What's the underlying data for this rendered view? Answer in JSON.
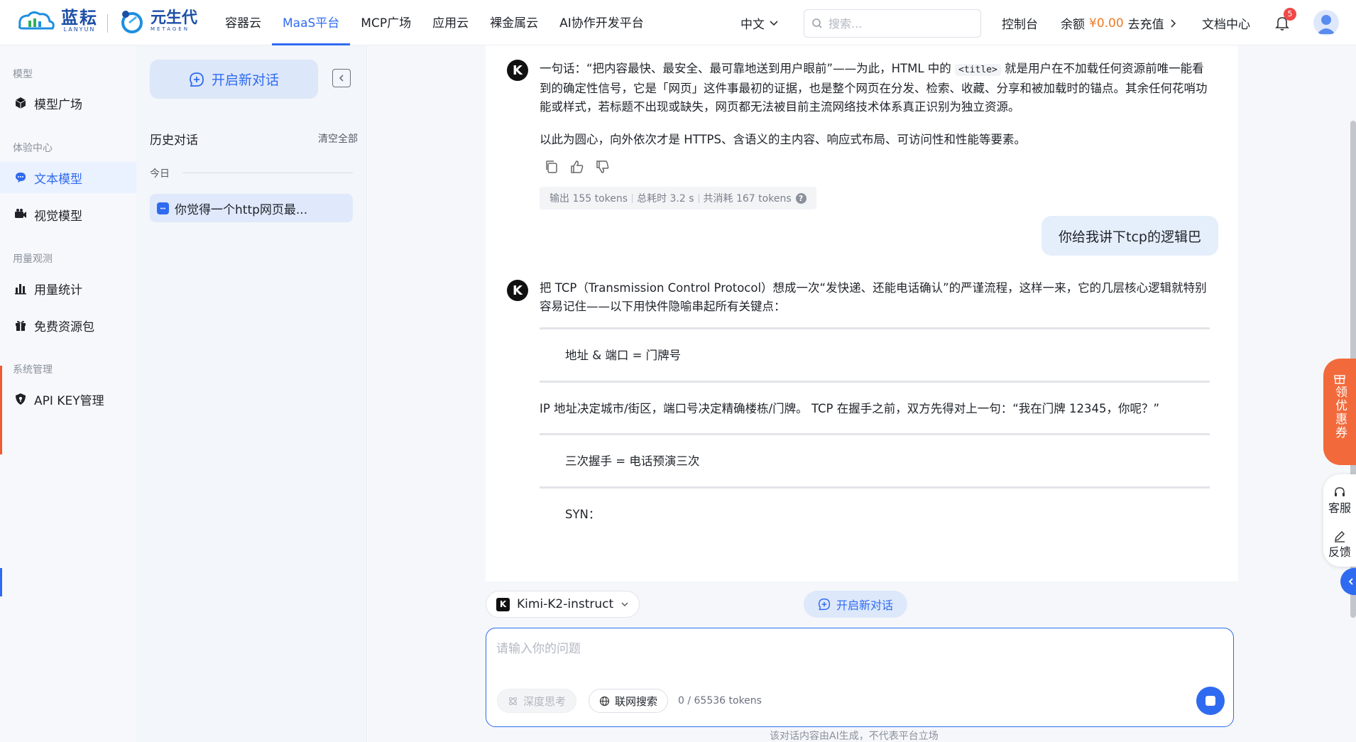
{
  "brand": {
    "logo1_name": "蓝耘",
    "logo1_sub": "LANYUN",
    "logo2_name": "元生代",
    "logo2_sub": "METAGEN"
  },
  "nav": {
    "items": [
      "容器云",
      "MaaS平台",
      "MCP广场",
      "应用云",
      "裸金属云",
      "AI协作开发平台"
    ],
    "active": "MaaS平台",
    "language": "中文",
    "search_placeholder": "搜索...",
    "console": "控制台",
    "balance_label": "余额",
    "balance_amount": "¥0.00",
    "recharge": "去充值",
    "docs": "文档中心",
    "notification_count": "5"
  },
  "sidebar": {
    "groups": [
      {
        "title": "模型",
        "items": [
          {
            "label": "模型广场",
            "icon": "cube-icon"
          }
        ]
      },
      {
        "title": "体验中心",
        "items": [
          {
            "label": "文本模型",
            "icon": "chat-icon",
            "active": true
          },
          {
            "label": "视觉模型",
            "icon": "camera-icon"
          }
        ]
      },
      {
        "title": "用量观测",
        "items": [
          {
            "label": "用量统计",
            "icon": "bar-chart-icon"
          },
          {
            "label": "免费资源包",
            "icon": "gift-icon"
          }
        ]
      },
      {
        "title": "系统管理",
        "items": [
          {
            "label": "API KEY管理",
            "icon": "shield-icon"
          }
        ]
      }
    ]
  },
  "history": {
    "new_chat": "开启新对话",
    "title": "历史对话",
    "clear_all": "清空全部",
    "today": "今日",
    "items": [
      "你觉得一个http网页最..."
    ]
  },
  "chat": {
    "answer1_p1_a": "一句话：“把内容最快、最安全、最可靠地送到用户眼前”——为此，HTML 中的",
    "answer1_code": "<title>",
    "answer1_p1_b": "就是用户在不加载任何资源前唯一能看到的确定性信号，它是「网页」这件事最初的证据，也是整个网页在分发、检索、收藏、分享和被加载时的锚点。其余任何花哨功能或样式，若标题不出现或缺失，网页都无法被目前主流网络技术体系真正识别为独立资源。",
    "answer1_p2": "以此为圆心，向外依次才是 HTTPS、含语义的主内容、响应式布局、可访问性和性能等要素。",
    "tokens_output": "输出 155 tokens",
    "tokens_time": "总耗时 3.2 s",
    "tokens_total": "共消耗 167 tokens",
    "user_question": "你给我讲下tcp的逻辑巴",
    "answer2_intro": "把 TCP（Transmission Control Protocol）想成一次“发快递、还能电话确认”的严谨流程，这样一来，它的几层核心逻辑就特别容易记住——以下用快件隐喻串起所有关键点：",
    "answer2_h1": "地址 & 端口 = 门牌号",
    "answer2_p1": "IP 地址决定城市/街区，端口号决定精确楼栋/门牌。 TCP 在握手之前，双方先得对上一句：“我在门牌 12345，你呢？”",
    "answer2_h2": "三次握手 = 电话预演三次",
    "answer2_h3": "SYN："
  },
  "composer": {
    "model": "Kimi-K2-instruct",
    "new_chat": "开启新对话",
    "placeholder": "请输入你的问题",
    "deep_think": "深度思考",
    "web_search": "联网搜索",
    "token_count": "0 / 65536 tokens",
    "disclaimer": "该对话内容由AI生成，不代表平台立场"
  },
  "floating": {
    "coupon": "领优惠券",
    "service": "客服",
    "feedback": "反馈"
  },
  "colors": {
    "accent": "#2f6bf0",
    "coupon": "#f26a3b",
    "balance": "#f07a24"
  }
}
